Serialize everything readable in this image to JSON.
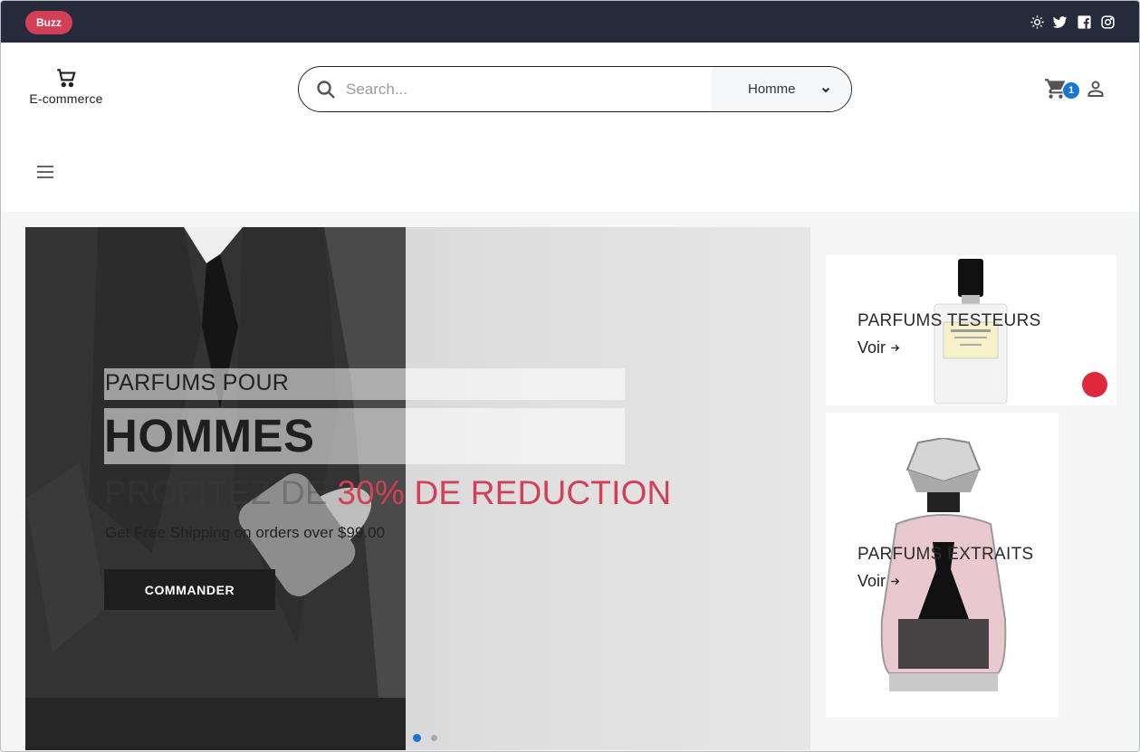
{
  "topbar": {
    "badge": "Buzz",
    "icons": [
      "sun-icon",
      "twitter-icon",
      "facebook-icon",
      "instagram-icon"
    ]
  },
  "header": {
    "logo_text": "E-commerce",
    "search": {
      "placeholder": "Search...",
      "category": "Homme"
    },
    "cart_count": "1"
  },
  "hero": {
    "subtitle": "PARFUMS POUR",
    "title": "HOMMES",
    "promo_prefix": "PROFITEZ DE ",
    "promo_highlight": "30% DE REDUCTION",
    "note": "Get Free Shipping on orders over $99.00",
    "button": "COMMANDER",
    "slides_total": 2,
    "slide_active": 1
  },
  "cards": [
    {
      "title": "PARFUMS TESTEURS",
      "link": "Voir"
    },
    {
      "title": "PARFUMS EXTRAITS",
      "link": "Voir"
    }
  ],
  "colors": {
    "topbar": "#252b3b",
    "accent": "#d23f57",
    "badge_blue": "#1976d2"
  }
}
